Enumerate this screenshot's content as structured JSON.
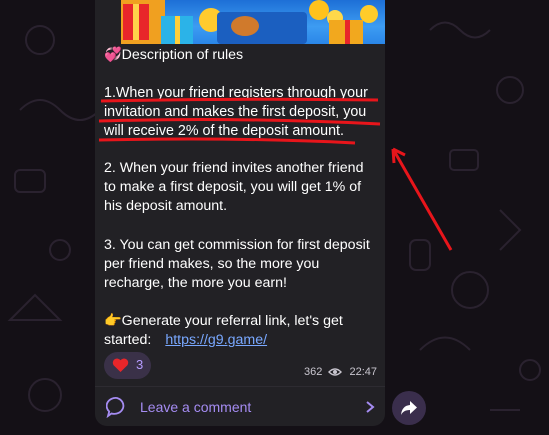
{
  "post": {
    "heading": "💞Description of rules",
    "rule1": "1.When your friend registers through your invitation and makes the first deposit, you will receive 2% of the deposit amount.",
    "rule2": "2. When your friend invites another friend to make a first deposit, you will get 1% of his deposit amount.",
    "rule3": "3. You can get commission for first deposit per friend makes, so the more you recharge, the more you earn!",
    "generate": "👉Generate your referral link, let's get started:",
    "link": "https://g9.game/"
  },
  "reactions": {
    "emoji": "heart-emoji",
    "count": "3"
  },
  "meta": {
    "views": "362",
    "time": "22:47"
  },
  "comments": {
    "label": "Leave a comment"
  },
  "colors": {
    "bubble": "#222125",
    "accent": "#a58cf2",
    "link": "#79a8ff",
    "annotation": "#e8151b"
  }
}
